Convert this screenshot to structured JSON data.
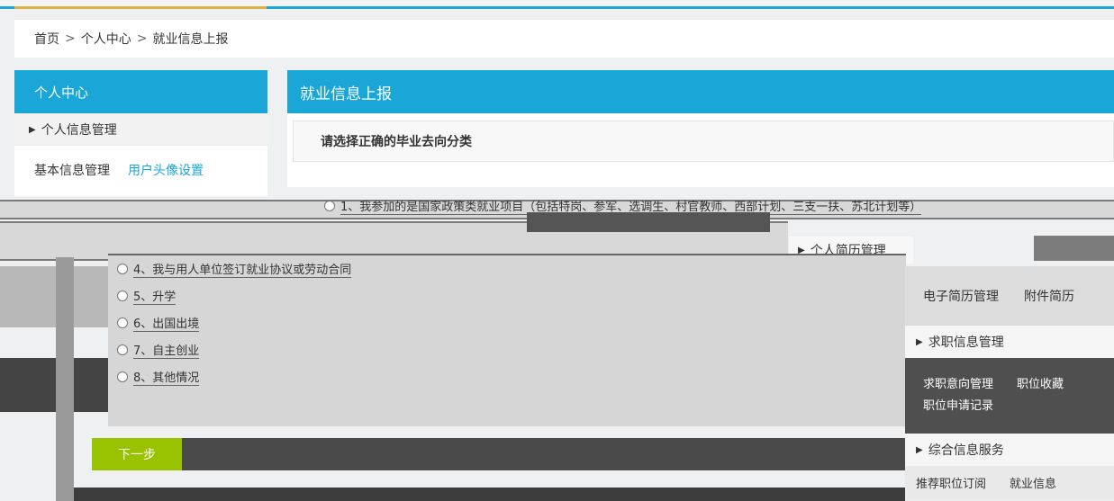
{
  "breadcrumb": {
    "home": "首页",
    "center": "个人中心",
    "current": "就业信息上报"
  },
  "sidebar": {
    "title": "个人中心",
    "section_info": "个人信息管理",
    "link_basic": "基本信息管理",
    "link_avatar": "用户头像设置"
  },
  "panel": {
    "title": "就业信息上报",
    "question": "请选择正确的毕业去向分类",
    "option_1": "1、我参加的是国家政策类就业项目（包括特岗、参军、选调生、村官教师、西部计划、三支一扶、苏北计划等）"
  },
  "options": [
    {
      "label": "4、我与用人单位签订就业协议或劳动合同"
    },
    {
      "label": "5、升学"
    },
    {
      "label": "6、出国出境"
    },
    {
      "label": "7、自主创业"
    },
    {
      "label": "8、其他情况"
    }
  ],
  "next_button": "下一步",
  "right": {
    "resume_section": "个人简历管理",
    "resume_links": "电子简历管理　　附件简历",
    "job_section": "求职信息管理",
    "job_links_line1": "求职意向管理　　职位收藏",
    "job_links_line2": "职位申请记录",
    "service_section": "综合信息服务",
    "service_links": "推荐职位订阅　　就业信息"
  },
  "colors": {
    "accent": "#1aa7d8",
    "button": "#99c300"
  }
}
